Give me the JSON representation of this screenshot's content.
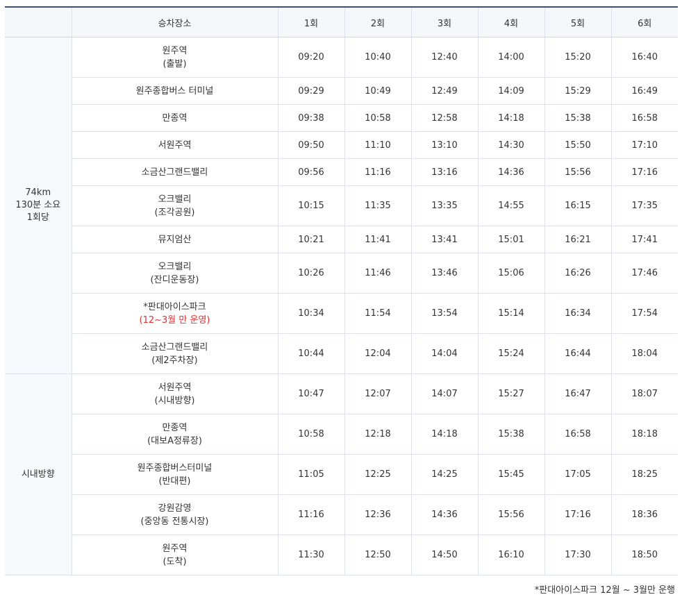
{
  "table": {
    "headers": [
      "",
      "승차장소",
      "1회",
      "2회",
      "3회",
      "4회",
      "5회",
      "6회"
    ],
    "groups": [
      {
        "line1": "74km",
        "line2": "130분 소요",
        "line3": "1회당"
      },
      {
        "line1": "시내방향"
      }
    ],
    "rows": [
      {
        "place": "원주역",
        "sub": "(출발)",
        "times": [
          "09:20",
          "10:40",
          "12:40",
          "14:00",
          "15:20",
          "16:40"
        ]
      },
      {
        "place": "원주종합버스 터미널",
        "times": [
          "09:29",
          "10:49",
          "12:49",
          "14:09",
          "15:29",
          "16:49"
        ]
      },
      {
        "place": "만종역",
        "times": [
          "09:38",
          "10:58",
          "12:58",
          "14:18",
          "15:38",
          "16:58"
        ]
      },
      {
        "place": "서원주역",
        "times": [
          "09:50",
          "11:10",
          "13:10",
          "14:30",
          "15:50",
          "17:10"
        ]
      },
      {
        "place": "소금산그랜드밸리",
        "times": [
          "09:56",
          "11:16",
          "13:16",
          "14:36",
          "15:56",
          "17:16"
        ]
      },
      {
        "place": "오크밸리",
        "sub": "(조각공원)",
        "times": [
          "10:15",
          "11:35",
          "13:35",
          "14:55",
          "16:15",
          "17:35"
        ]
      },
      {
        "place": "뮤지엄산",
        "times": [
          "10:21",
          "11:41",
          "13:41",
          "15:01",
          "16:21",
          "17:41"
        ]
      },
      {
        "place": "오크밸리",
        "sub": "(잔디운동장)",
        "times": [
          "10:26",
          "11:46",
          "13:46",
          "15:06",
          "16:26",
          "17:46"
        ]
      },
      {
        "place": "*판대아이스파크",
        "sub": "(12~3월 만 운영)",
        "times": [
          "10:34",
          "11:54",
          "13:54",
          "15:14",
          "16:34",
          "17:54"
        ]
      },
      {
        "place": "소금산그랜드밸리",
        "sub": "(제2주차장)",
        "times": [
          "10:44",
          "12:04",
          "14:04",
          "15:24",
          "16:44",
          "18:04"
        ]
      },
      {
        "place": "서원주역",
        "sub": "(시내방향)",
        "times": [
          "10:47",
          "12:07",
          "14:07",
          "15:27",
          "16:47",
          "18:07"
        ]
      },
      {
        "place": "만종역",
        "sub": "(대보A정류장)",
        "times": [
          "10:58",
          "12:18",
          "14:18",
          "15:38",
          "16:58",
          "18:18"
        ]
      },
      {
        "place": "원주종합버스터미널",
        "sub": "(반대편)",
        "times": [
          "11:05",
          "12:25",
          "14:25",
          "15:45",
          "17:05",
          "18:25"
        ]
      },
      {
        "place": "강원감영",
        "sub": "(중앙동 전통시장)",
        "times": [
          "11:16",
          "12:36",
          "14:36",
          "15:56",
          "17:16",
          "18:36"
        ]
      },
      {
        "place": "원주역",
        "sub": "(도착)",
        "times": [
          "11:30",
          "12:50",
          "14:50",
          "16:10",
          "17:30",
          "18:50"
        ]
      }
    ]
  },
  "footnote": "*판대아이스파크 12월 ~ 3월만 운행",
  "colors": {
    "header_border": "#3a4f7a",
    "header_bg": "#f4f6fa",
    "notice_red": "#e02f2f"
  }
}
